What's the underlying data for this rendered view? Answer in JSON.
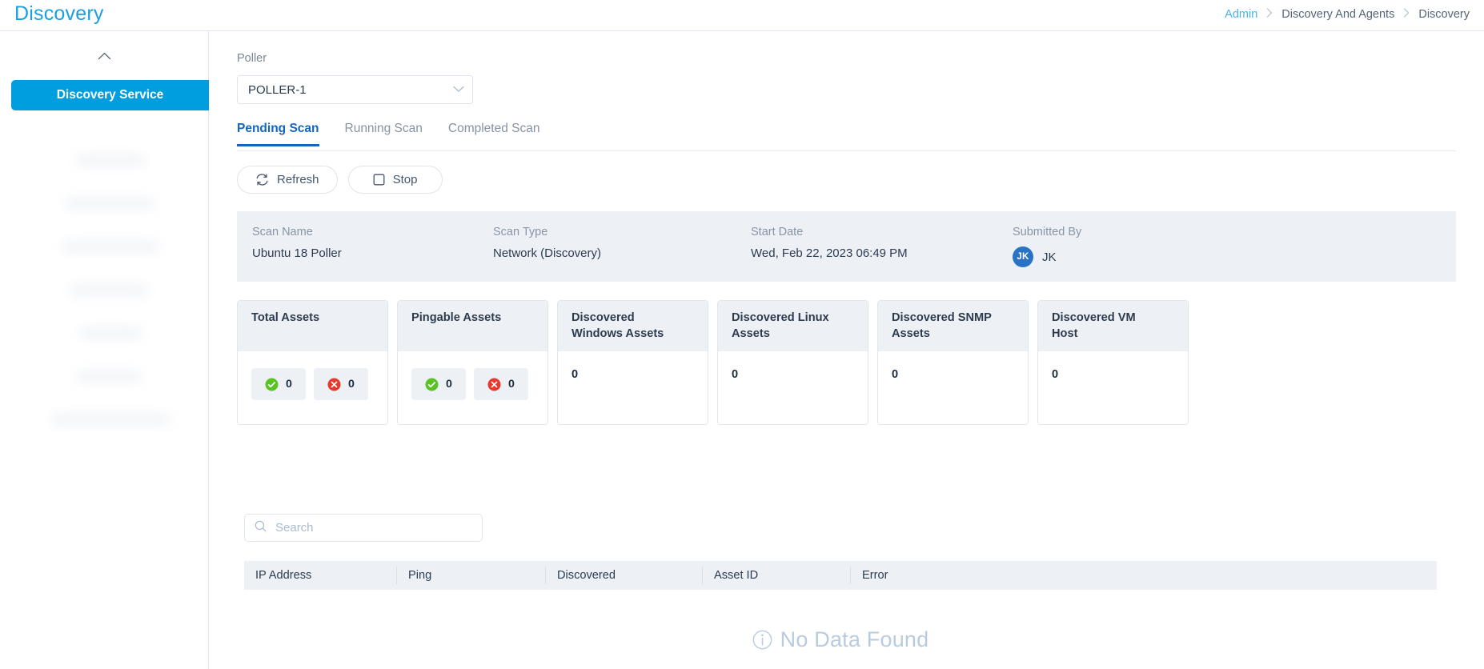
{
  "header": {
    "app_title": "Discovery",
    "breadcrumb": [
      {
        "label": "Admin",
        "type": "link"
      },
      {
        "label": "Discovery And Agents",
        "type": "static"
      },
      {
        "label": "Discovery",
        "type": "static"
      }
    ],
    "separator": "›"
  },
  "sidebar": {
    "collapse_icon": "chevron-up-icon",
    "active_item": "Discovery Service"
  },
  "poller": {
    "label": "Poller",
    "selected": "POLLER-1",
    "chevron_icon": "chevron-down-icon"
  },
  "tabs": [
    {
      "label": "Pending Scan",
      "active": true
    },
    {
      "label": "Running Scan",
      "active": false
    },
    {
      "label": "Completed Scan",
      "active": false
    }
  ],
  "actions": [
    {
      "label": "Refresh",
      "icon": "refresh-icon"
    },
    {
      "label": "Stop",
      "icon": "stop-square-icon"
    }
  ],
  "scan_info": [
    {
      "key": "Scan Name",
      "value": "Ubuntu 18 Poller"
    },
    {
      "key": "Scan Type",
      "value": "Network (Discovery)"
    },
    {
      "key": "Start Date",
      "value": "Wed, Feb 22, 2023 06:49 PM"
    },
    {
      "key": "Submitted By",
      "value": "JK",
      "avatar_initials": "JK"
    }
  ],
  "cards": [
    {
      "title": "Total Assets",
      "type": "split",
      "success_value": "0",
      "error_value": "0"
    },
    {
      "title": "Pingable Assets",
      "type": "split",
      "success_value": "0",
      "error_value": "0"
    },
    {
      "title_line1": "Discovered",
      "title_line2": "Windows Assets",
      "type": "single",
      "value": "0"
    },
    {
      "title_line1": "Discovered Linux",
      "title_line2": "Assets",
      "type": "single",
      "value": "0"
    },
    {
      "title_line1": "Discovered SNMP",
      "title_line2": "Assets",
      "type": "single",
      "value": "0"
    },
    {
      "title_line1": "Discovered VM",
      "title_line2": "Host",
      "type": "single",
      "value": "0"
    }
  ],
  "search": {
    "placeholder": "Search",
    "value": "",
    "icon": "search-icon"
  },
  "table": {
    "columns": [
      "IP Address",
      "Ping",
      "Discovered",
      "Asset ID",
      "Error"
    ],
    "rows": [],
    "empty_message": "No Data Found",
    "empty_icon": "info-circle-icon"
  },
  "colors": {
    "brand_blue": "#009ede",
    "title_blue": "#1aa0e0",
    "tab_active": "#1565c0",
    "panel_gray": "#edf1f6",
    "success_green": "#58c322",
    "error_red": "#e8392e",
    "avatar_blue": "#2a72c4",
    "empty_text": "#b8cbdf"
  }
}
